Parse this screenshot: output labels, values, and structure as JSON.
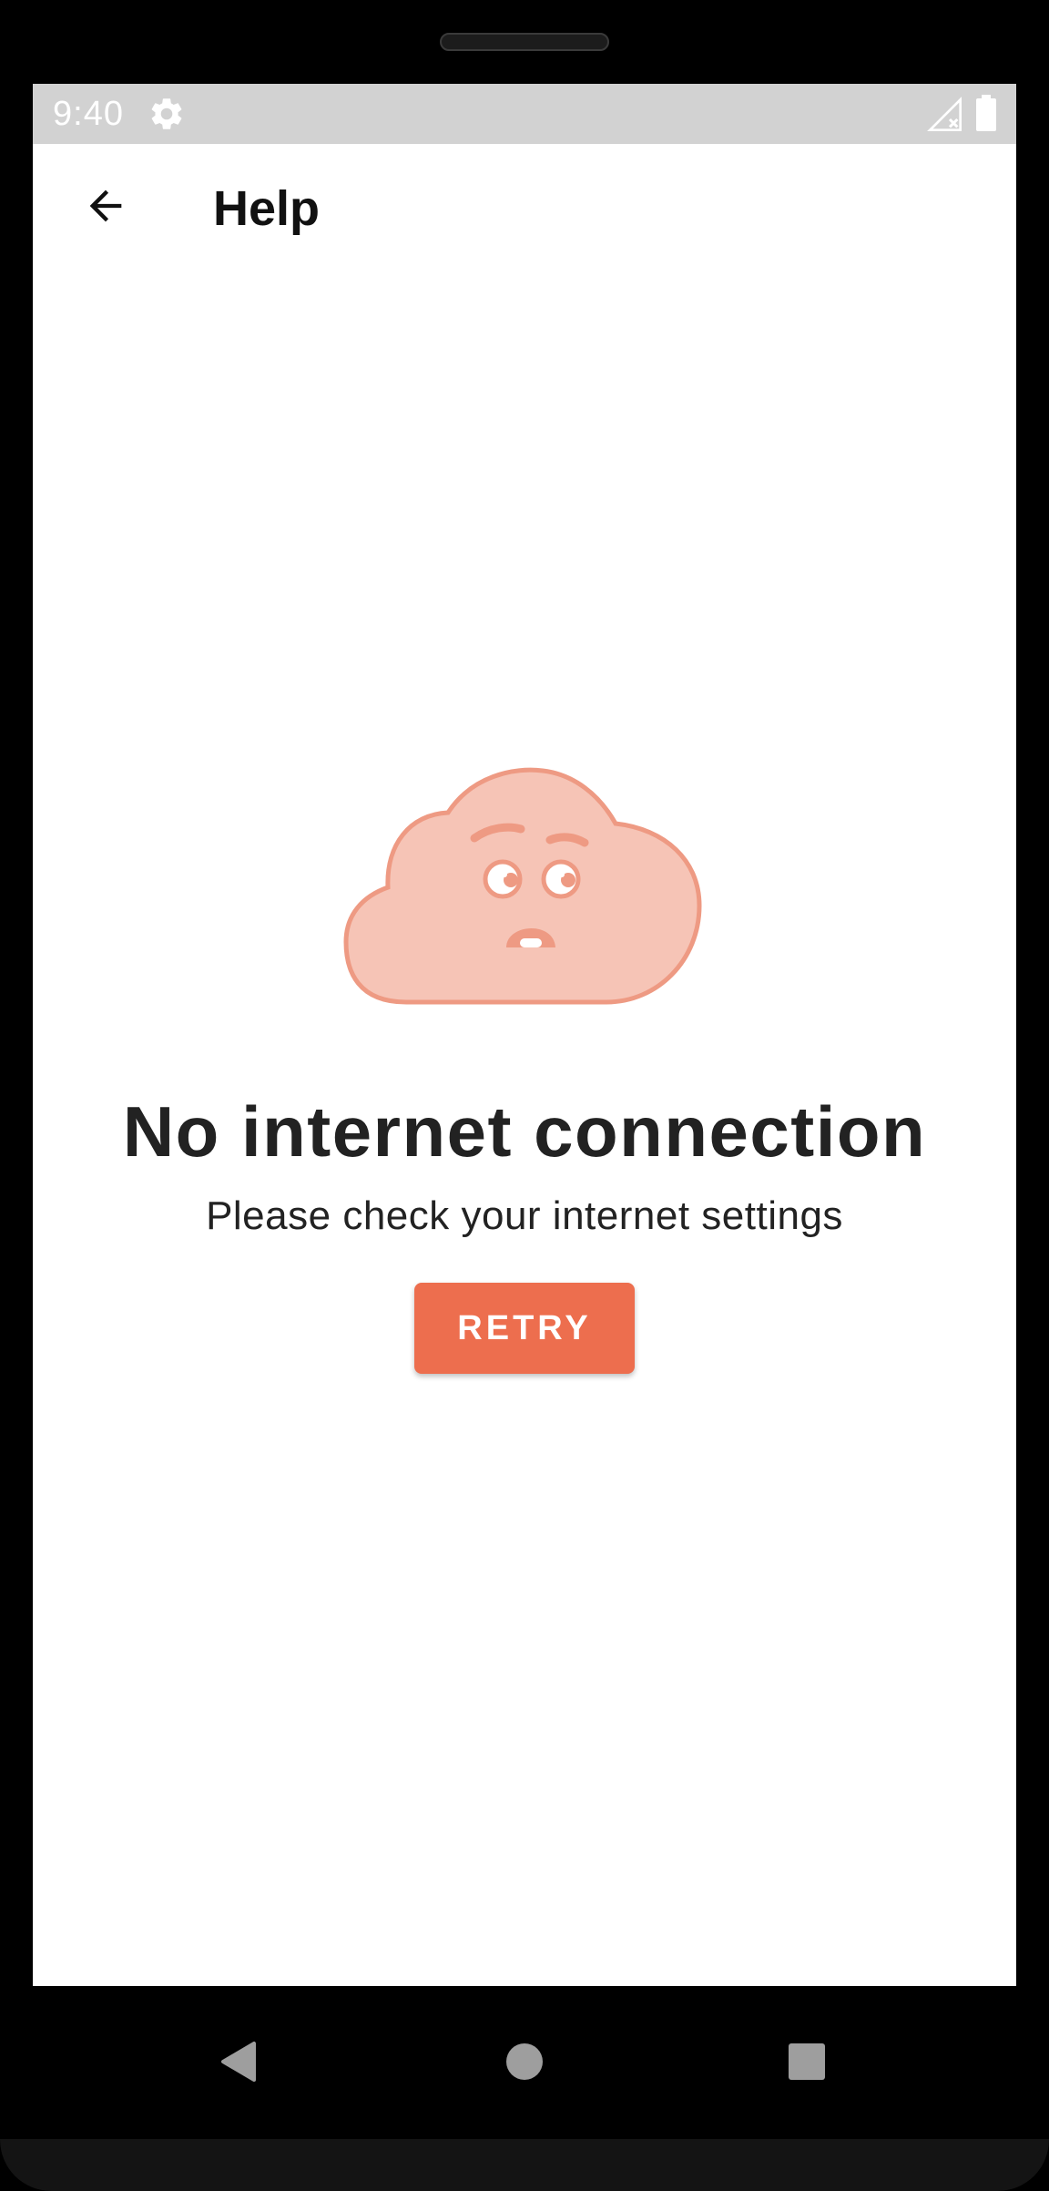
{
  "status_bar": {
    "time": "9:40",
    "icons": [
      "gear-icon",
      "signal-off-icon",
      "battery-icon"
    ]
  },
  "app_bar": {
    "back_icon": "arrow-left-icon",
    "title": "Help"
  },
  "empty_state": {
    "illustration": "sad-cloud-icon",
    "title": "No internet connection",
    "message": "Please check your internet settings",
    "retry_label": "RETRY"
  },
  "nav_bar": {
    "icons": [
      "back-triangle-icon",
      "home-circle-icon",
      "recents-square-icon"
    ]
  },
  "colors": {
    "accent": "#ED6E4E",
    "cloud_fill": "#F6C4B6",
    "cloud_stroke": "#EE9A83",
    "status_bar": "#D2D2D2",
    "text": "#222222"
  }
}
